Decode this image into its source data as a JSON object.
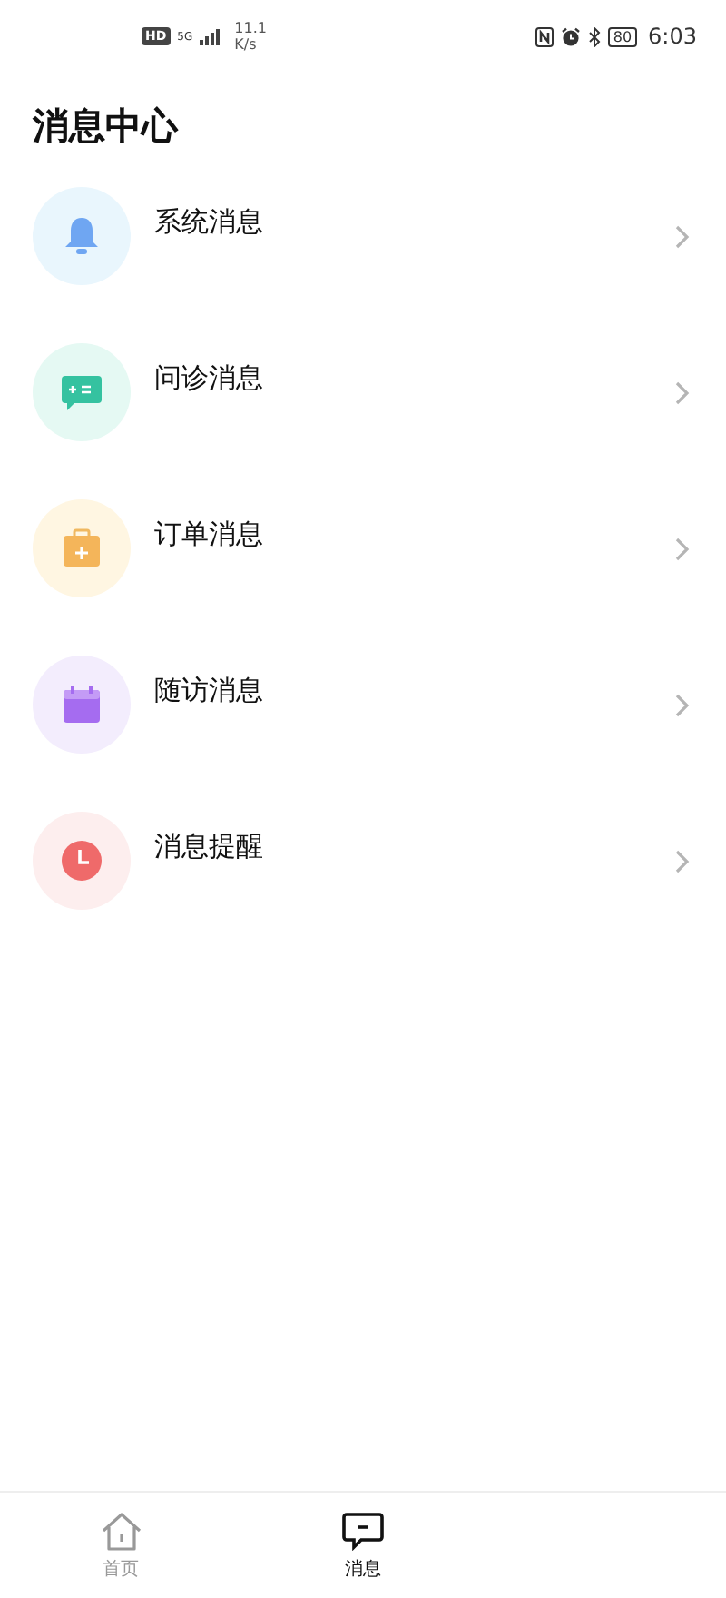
{
  "status_bar": {
    "hd": "HD",
    "network": "5G",
    "speed": "11.1",
    "speed_unit": "K/s",
    "battery": "80",
    "time": "6:03"
  },
  "title": "消息中心",
  "items": [
    {
      "label": "系统消息",
      "kind": "bell",
      "color": "#e9f6fd"
    },
    {
      "label": "问诊消息",
      "kind": "chat",
      "color": "#e5f9f3"
    },
    {
      "label": "订单消息",
      "kind": "case",
      "color": "#fff6e2"
    },
    {
      "label": "随访消息",
      "kind": "calendar",
      "color": "#f3edfd"
    },
    {
      "label": "消息提醒",
      "kind": "clock",
      "color": "#fdeeee"
    }
  ],
  "tabs": [
    {
      "label": "首页",
      "kind": "home",
      "selected": false
    },
    {
      "label": "消息",
      "kind": "chat",
      "selected": true
    }
  ]
}
